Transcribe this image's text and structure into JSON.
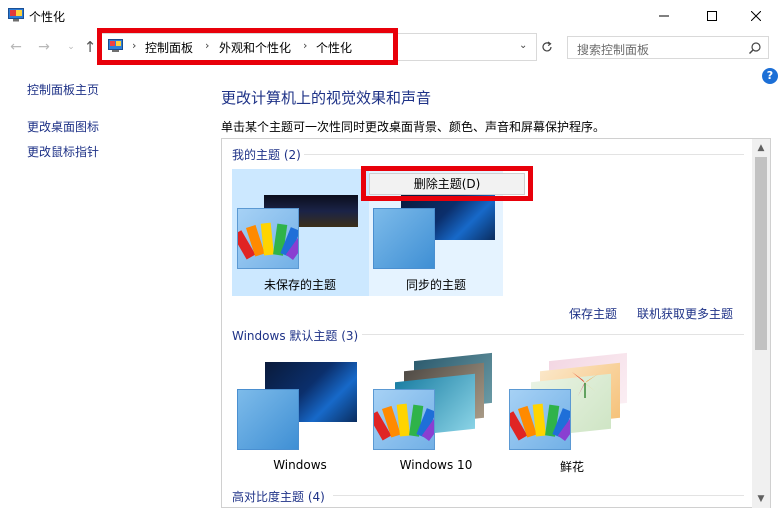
{
  "window": {
    "title": "个性化",
    "icon": "personalization-icon"
  },
  "address": {
    "breadcrumbs": [
      "控制面板",
      "外观和个性化",
      "个性化"
    ],
    "search_placeholder": "搜索控制面板"
  },
  "sidebar": {
    "items": [
      {
        "label": "控制面板主页"
      },
      {
        "label": "更改桌面图标"
      },
      {
        "label": "更改鼠标指针"
      }
    ]
  },
  "main": {
    "title": "更改计算机上的视觉效果和声音",
    "description": "单击某个主题可一次性同时更改桌面背景、颜色、声音和屏幕保护程序。"
  },
  "groups": {
    "my": {
      "title": "我的主题",
      "count": "(2)"
    },
    "default": {
      "title": "Windows 默认主题",
      "count": "(3)"
    },
    "contrast": {
      "title": "高对比度主题",
      "count": "(4)"
    }
  },
  "my_themes": [
    {
      "label": "未保存的主题",
      "selected": true
    },
    {
      "label": "同步的主题",
      "selected": false
    }
  ],
  "default_themes": [
    {
      "label": "Windows"
    },
    {
      "label": "Windows 10"
    },
    {
      "label": "鲜花"
    }
  ],
  "context_menu": {
    "delete_label": "删除主题(D)"
  },
  "links": {
    "save_theme": "保存主题",
    "get_more": "联机获取更多主题"
  },
  "colors": {
    "accent_link": "#1e3287",
    "highlight_red": "#e8000a",
    "selected_bg": "#cce8ff"
  }
}
